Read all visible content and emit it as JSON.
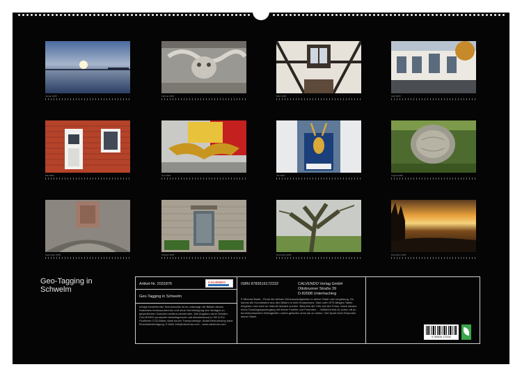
{
  "calendar": {
    "title": "Geo-Tagging in Schwelm",
    "months": [
      {
        "caption": "Januar 2025",
        "subject": "sunset-over-water"
      },
      {
        "caption": "Februar 2025",
        "subject": "stone-relief-ornament"
      },
      {
        "caption": "März 2025",
        "subject": "half-timbered-facade"
      },
      {
        "caption": "April 2025",
        "subject": "baroque-house-facade"
      },
      {
        "caption": "Mai 2025",
        "subject": "red-brick-house-door"
      },
      {
        "caption": "Juni 2025",
        "subject": "golden-eagle-sculpture"
      },
      {
        "caption": "Juli 2025",
        "subject": "deer-head-sign"
      },
      {
        "caption": "August 2025",
        "subject": "tree-stump"
      },
      {
        "caption": "September 2025",
        "subject": "stone-coat-of-arms"
      },
      {
        "caption": "Oktober 2025",
        "subject": "stone-house-door"
      },
      {
        "caption": "November 2025",
        "subject": "old-tree"
      },
      {
        "caption": "Dezember 2025",
        "subject": "winter-sunset"
      }
    ]
  },
  "info": {
    "article": "Artikel-Nr. 2031876",
    "name": "Geo-Tagging in Schwelm",
    "brand": "CALVENDO",
    "isbn": "ISBN 9783516172232",
    "publisher": [
      "CALVENDO Verlag GmbH",
      "Ottobrunner Straße 39",
      "D-82008 Unterhaching"
    ],
    "legal": "Infolge bestehender Schutzrechte ist es untersagt, die Blätter dieses Kalenders herauszutrennen und ohne Genehmigung des Verlages zu gewerblichen Zwecken weiterzuverwenden. Alle Angaben ohne Gewähr. CALVENDO produziert bedarfsgerecht und klimabewusst in DE & EU. Positivere CO2-Bilanz dank kurzer Transportwege. Abfall-Reduzierung dank Einzelstückfertigung. E-Mail: info@calvendo.com - www.calvendo.com",
    "description": "© Michael Barth - Finde die kleinen Sehenswürdigkeiten in deiner Stadt und Umgebung. Du kannst die Koordinaten aus den Bildern in dein Smartphone, Navi oder GPS-fähiges Tablet eingeben und auch im Internet danach suchen. Besuche die Orte auf den Fotos, mach daraus einen Sonntagsspaziergang mit deiner Familie und Freunden ... Vielleicht bist du schon oft an bemerkenswerten Kleinigkeiten vorbei gelaufen ohne sie zu sehen. Viel Spaß beim Erkunden deiner Stadt.",
    "barcode_number": "9 783516 172232"
  }
}
